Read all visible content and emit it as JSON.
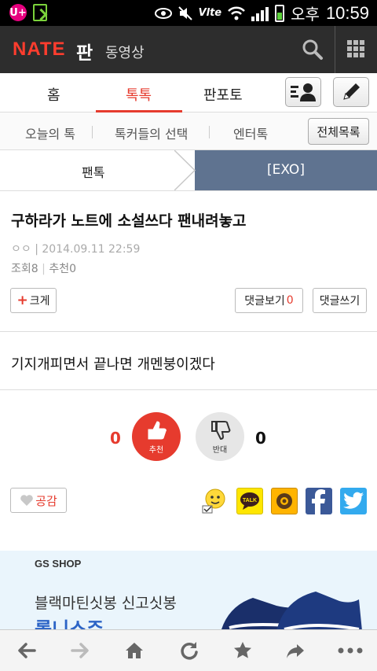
{
  "status_bar": {
    "carrier_icon": "U+",
    "network": "Vlte",
    "ampm": "오후",
    "time": "10:59"
  },
  "header": {
    "logo": "NATE",
    "title": "판",
    "video_link": "동영상",
    "icons": [
      "search-icon",
      "grid-menu-icon"
    ]
  },
  "tabs": {
    "items": [
      "홈",
      "톡톡",
      "판포토"
    ],
    "active": "톡톡",
    "icons": [
      "my-profile-icon",
      "write-pencil-icon"
    ]
  },
  "subnav": {
    "items": [
      "오늘의 톡",
      "톡커들의 선택",
      "엔터톡"
    ],
    "all_button": "전체목록"
  },
  "breadcrumb": {
    "parent": "팬톡",
    "current": "[EXO]"
  },
  "post": {
    "title": "구하라가 노트에 소설쓰다 팬내려놓고",
    "author": "ㅇㅇ",
    "date": "2014.09.11 22:59",
    "views_label": "조회",
    "views": "8",
    "recommend_label": "추천",
    "recommend": "0",
    "enlarge_button": "크게",
    "view_comments_label": "댓글보기",
    "comment_count": "0",
    "write_comment_button": "댓글쓰기",
    "body": "기지개피면서 끝나면 개멘붕이겠다"
  },
  "vote": {
    "up_count": "0",
    "up_label": "추천",
    "down_count": "0",
    "down_label": "반대"
  },
  "empathy_button": "공감",
  "share_icons": [
    "emoticon-icon",
    "kakaotalk-icon",
    "kakaostory-icon",
    "facebook-icon",
    "twitter-icon"
  ],
  "share_talk_text": "TALK",
  "ad": {
    "brand": "GS SHOP",
    "text": "블랙마틴싯봉 신고싯봉",
    "headline": "롤니스주"
  },
  "bottom_bar": {
    "icons": [
      "back-icon",
      "forward-icon",
      "home-icon",
      "refresh-icon",
      "bookmark-star-icon",
      "share-icon",
      "more-icon"
    ]
  },
  "colors": {
    "accent": "#e63b2e",
    "header_bg": "#2d2d2d",
    "breadcrumb_current_bg": "#5f7390",
    "facebook": "#3b5998",
    "twitter": "#1da1f2",
    "kakao": "#ffe600"
  }
}
